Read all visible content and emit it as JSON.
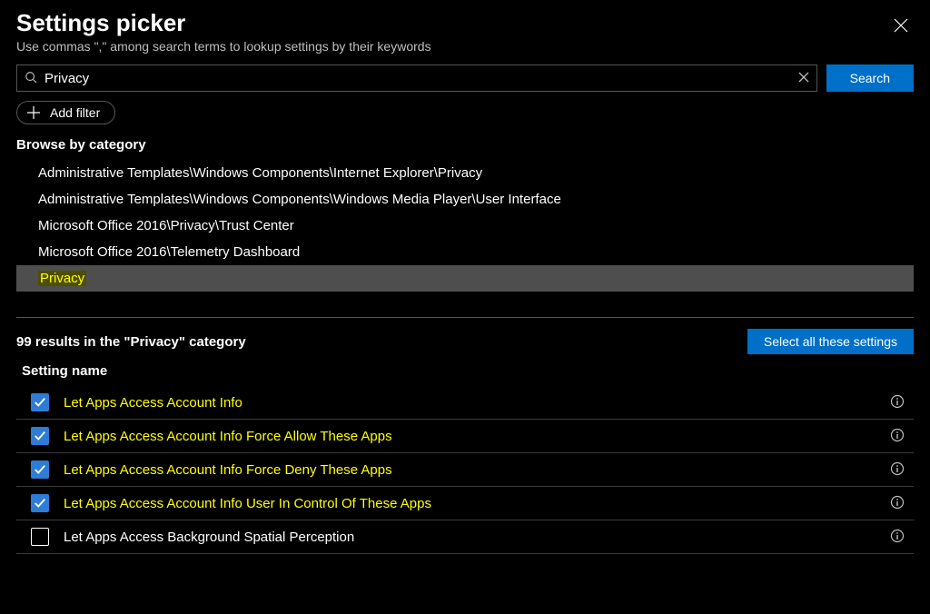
{
  "header": {
    "title": "Settings picker",
    "subtitle": "Use commas \",\" among search terms to lookup settings by their keywords"
  },
  "search": {
    "value": "Privacy",
    "button": "Search",
    "add_filter": "Add filter"
  },
  "browse": {
    "label": "Browse by category",
    "items": [
      {
        "text": "Administrative Templates\\Windows Components\\Internet Explorer\\Privacy",
        "selected": false
      },
      {
        "text": "Administrative Templates\\Windows Components\\Windows Media Player\\User Interface",
        "selected": false
      },
      {
        "text": "Microsoft Office 2016\\Privacy\\Trust Center",
        "selected": false
      },
      {
        "text": "Microsoft Office 2016\\Telemetry Dashboard",
        "selected": false
      },
      {
        "text": "Privacy",
        "selected": true
      }
    ]
  },
  "results": {
    "summary": "99 results in the \"Privacy\" category",
    "select_all": "Select all these settings",
    "column": "Setting name",
    "rows": [
      {
        "label": "Let Apps Access Account Info",
        "checked": true,
        "highlight": true
      },
      {
        "label": "Let Apps Access Account Info Force Allow These Apps",
        "checked": true,
        "highlight": true
      },
      {
        "label": "Let Apps Access Account Info Force Deny These Apps",
        "checked": true,
        "highlight": true
      },
      {
        "label": "Let Apps Access Account Info User In Control Of These Apps",
        "checked": true,
        "highlight": true
      },
      {
        "label": "Let Apps Access Background Spatial Perception",
        "checked": false,
        "highlight": false
      }
    ]
  }
}
